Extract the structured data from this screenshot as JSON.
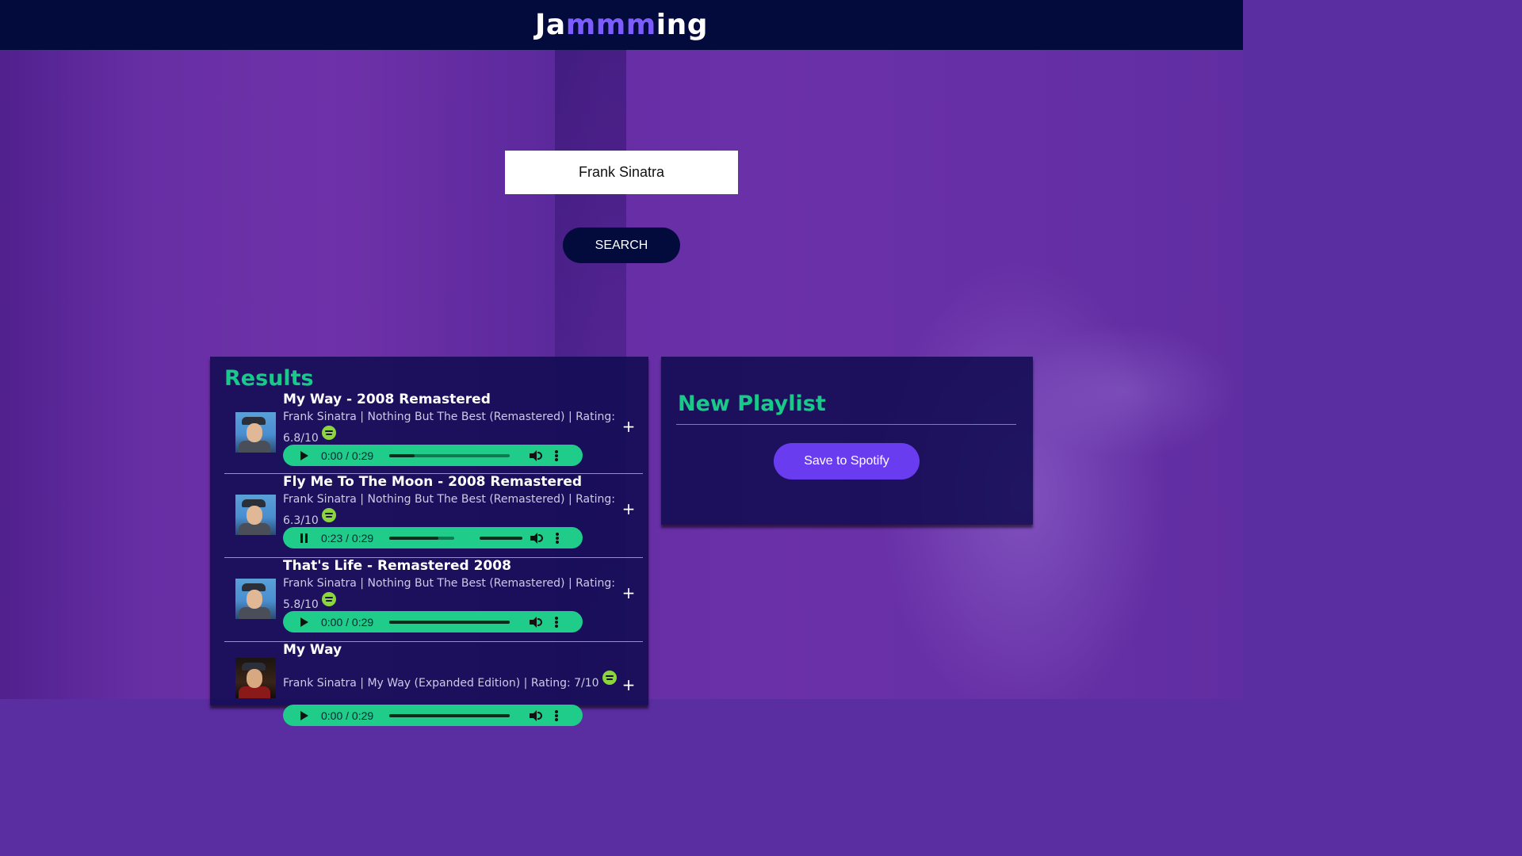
{
  "app": {
    "logo": {
      "part1": "Ja",
      "part2": "mmm",
      "part3": "ing"
    }
  },
  "search": {
    "value": "Frank Sinatra",
    "button_label": "SEARCH"
  },
  "results": {
    "title": "Results",
    "tracks": [
      {
        "name": "My Way - 2008 Remastered",
        "info": "Frank Sinatra | Nothing But The Best (Remastered) | Rating: 6.8/10",
        "player": {
          "state": "paused",
          "time": "0:00 / 0:29",
          "progress": 0.0
        },
        "add_label": "+"
      },
      {
        "name": "Fly Me To The Moon - 2008 Remastered",
        "info": "Frank Sinatra | Nothing But The Best (Remastered) | Rating: 6.3/10",
        "player": {
          "state": "playing",
          "time": "0:23 / 0:29",
          "progress": 0.79
        },
        "add_label": "+"
      },
      {
        "name": "That's Life - Remastered 2008",
        "info": "Frank Sinatra | Nothing But The Best (Remastered) | Rating: 5.8/10",
        "player": {
          "state": "paused",
          "time": "0:00 / 0:29",
          "progress": 0.0
        },
        "add_label": "+"
      },
      {
        "name": "My Way",
        "info": "Frank Sinatra | My Way (Expanded Edition) | Rating: 7/10",
        "player": {
          "state": "paused",
          "time": "0:00 / 0:29",
          "progress": 0.0
        },
        "add_label": "+"
      }
    ]
  },
  "playlist": {
    "title": "New Playlist",
    "save_label": "Save to Spotify"
  },
  "colors": {
    "header_bg": "#030b3d",
    "accent_green": "#18c98a",
    "player_green": "#1fcc8a",
    "logo_accent": "#7c5cff",
    "save_button": "#6a3cf0",
    "spotify_green": "#8bd63a"
  },
  "icons": {
    "play": "play-icon",
    "pause": "pause-icon",
    "volume": "volume-icon",
    "more": "more-vertical-icon",
    "spotify": "spotify-icon",
    "add": "plus-icon"
  }
}
